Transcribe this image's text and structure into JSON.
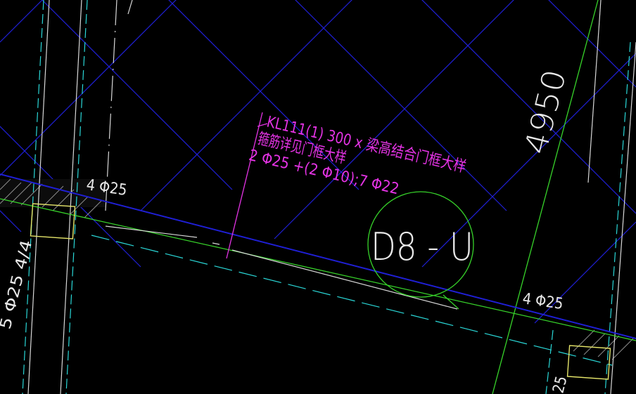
{
  "drawing": {
    "background": "#000000",
    "colors": {
      "grid": "#1f1fd6",
      "beam_edge": "#1f1fd6",
      "beam_face": "#d8d8d8",
      "axis": "#37d32a",
      "dashed": "#2ad8d8",
      "annotation": "#e433e4",
      "column": "#e6e66a",
      "hatch": "#8c8c8c",
      "text": "#e8e8e8"
    },
    "beam_label": {
      "line1": "KL111(1) 300 x 梁高结合门框大样",
      "line2": "箍筋详见门框大样",
      "line3": "2 Φ25 +(2 Φ10);7 Φ22"
    },
    "rebar_left": "4 Φ25",
    "rebar_right": "4 Φ25",
    "axis_bubble": "D8 - U",
    "dimension": "4950",
    "column_label": "5 Φ25 4/4",
    "partial_label": "25"
  }
}
